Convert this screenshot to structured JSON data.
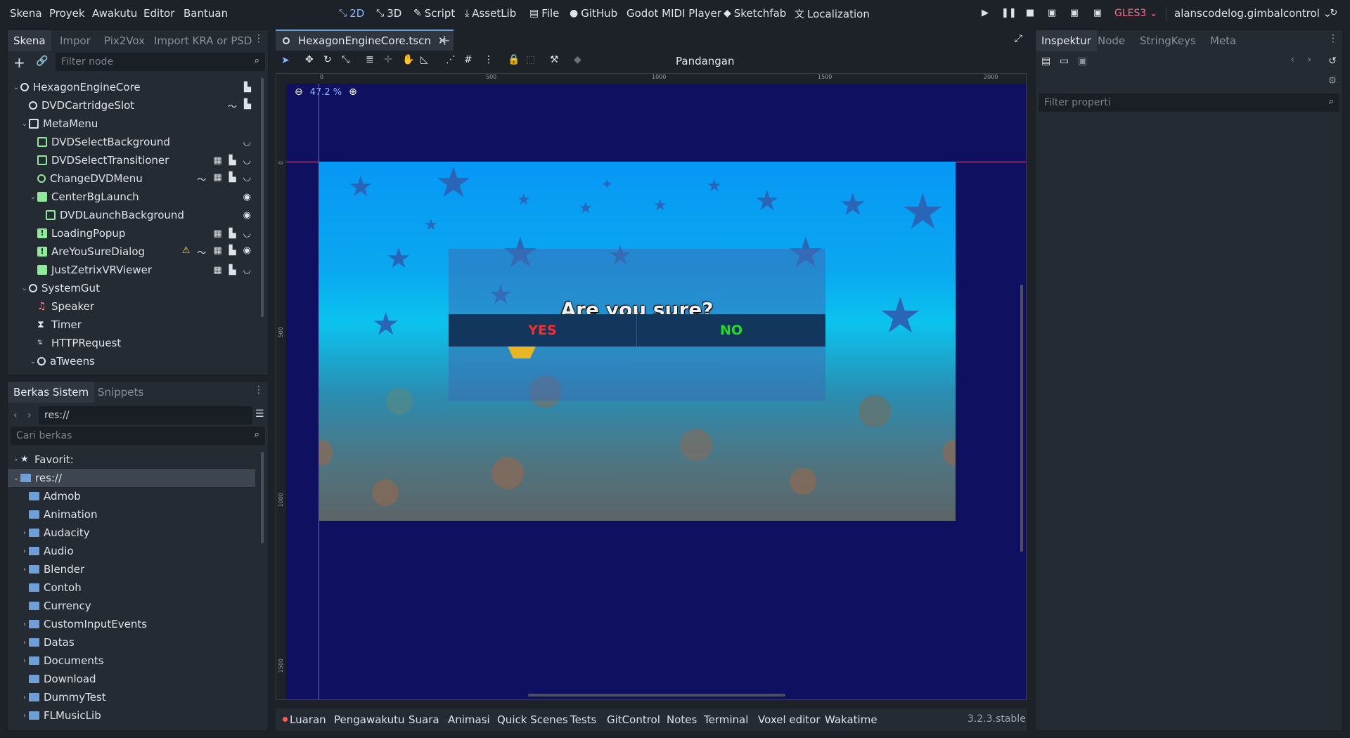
{
  "menu": [
    "Skena",
    "Proyek",
    "Awakutu",
    "Editor",
    "Bantuan"
  ],
  "workspaces": [
    {
      "label": "2D",
      "icon": "2d-icon"
    },
    {
      "label": "3D",
      "icon": "3d-icon"
    },
    {
      "label": "Script",
      "icon": "script-icon"
    },
    {
      "label": "AssetLib",
      "icon": "assetlib-icon"
    },
    {
      "label": "File",
      "icon": "file-icon"
    },
    {
      "label": "GitHub",
      "icon": "github-icon"
    },
    {
      "label": "Godot MIDI Player",
      "icon": ""
    },
    {
      "label": "Sketchfab",
      "icon": "sketchfab-icon"
    },
    {
      "label": "Localization",
      "icon": "localization-icon"
    }
  ],
  "renderer": "GLES3",
  "project_name": "alanscodelog.gimbalcontrol",
  "scene_dock": {
    "tabs": [
      "Skena",
      "Impor",
      "Pix2Vox",
      "Import KRA or PSD"
    ],
    "filter_placeholder": "Filter node",
    "nodes": [
      {
        "label": "HexagonEngineCore",
        "depth": 0,
        "expanded": true,
        "icon": "ring"
      },
      {
        "label": "DVDCartridgeSlot",
        "depth": 1,
        "icon": "ring"
      },
      {
        "label": "MetaMenu",
        "depth": 1,
        "expanded": true,
        "icon": "checkbox"
      },
      {
        "label": "DVDSelectBackground",
        "depth": 2,
        "icon": "texture"
      },
      {
        "label": "DVDSelectTransitioner",
        "depth": 2,
        "icon": "texture"
      },
      {
        "label": "ChangeDVDMenu",
        "depth": 2,
        "icon": "ring"
      },
      {
        "label": "CenterBgLaunch",
        "depth": 2,
        "expanded": true,
        "icon": "center"
      },
      {
        "label": "DVDLaunchBackground",
        "depth": 3,
        "icon": "texture"
      },
      {
        "label": "LoadingPopup",
        "depth": 2,
        "icon": "alert"
      },
      {
        "label": "AreYouSureDialog",
        "depth": 2,
        "icon": "alert"
      },
      {
        "label": "JustZetrixVRViewer",
        "depth": 2,
        "icon": "panel"
      },
      {
        "label": "SystemGut",
        "depth": 1,
        "expanded": true,
        "icon": "ring"
      },
      {
        "label": "Speaker",
        "depth": 2,
        "icon": "audio"
      },
      {
        "label": "Timer",
        "depth": 2,
        "icon": "timer"
      },
      {
        "label": "HTTPRequest",
        "depth": 2,
        "icon": "http"
      },
      {
        "label": "aTweens",
        "depth": 2,
        "expanded": true,
        "icon": "ring"
      }
    ]
  },
  "filesystem_dock": {
    "tabs": [
      "Berkas Sistem",
      "Snippets"
    ],
    "path": "res://",
    "search_placeholder": "Cari berkas",
    "items": [
      {
        "label": "Favorit:",
        "depth": 0,
        "icon": "star",
        "collapsed": true
      },
      {
        "label": "res://",
        "depth": 0,
        "icon": "folder",
        "expanded": true,
        "selected": true
      },
      {
        "label": "Admob",
        "depth": 1
      },
      {
        "label": "Animation",
        "depth": 1
      },
      {
        "label": "Audacity",
        "depth": 1,
        "collapsed": true
      },
      {
        "label": "Audio",
        "depth": 1,
        "collapsed": true
      },
      {
        "label": "Blender",
        "depth": 1,
        "collapsed": true
      },
      {
        "label": "Contoh",
        "depth": 1
      },
      {
        "label": "Currency",
        "depth": 1
      },
      {
        "label": "CustomInputEvents",
        "depth": 1,
        "collapsed": true
      },
      {
        "label": "Datas",
        "depth": 1,
        "collapsed": true
      },
      {
        "label": "Documents",
        "depth": 1,
        "collapsed": true
      },
      {
        "label": "Download",
        "depth": 1
      },
      {
        "label": "DummyTest",
        "depth": 1,
        "collapsed": true
      },
      {
        "label": "FLMusicLib",
        "depth": 1,
        "collapsed": true
      }
    ]
  },
  "editor": {
    "scene_tab": "HexagonEngineCore.tscn",
    "toolbar_view_label": "Pandangan",
    "zoom": "47.2 %",
    "ruler_h": [
      "0",
      "500",
      "1000",
      "1500",
      "2000"
    ],
    "ruler_v": [
      "0",
      "500",
      "1000",
      "1500"
    ]
  },
  "game": {
    "dialog_title": "Are you sure?sdffffffffffffffffffffffds",
    "yes_label": "YES",
    "no_label": "NO",
    "colors": {
      "yes": "#ff2a2a",
      "no": "#22dd22",
      "background_top": "#0797f5",
      "viewport": "#0f1060"
    }
  },
  "inspector": {
    "tabs": [
      "Inspektur",
      "Node",
      "StringKeys",
      "Meta"
    ],
    "filter_placeholder": "Filter properti"
  },
  "bottom_panel": {
    "tabs": [
      "Luaran",
      "Pengawakutu",
      "Suara",
      "Animasi",
      "Quick Scenes",
      "Tests",
      "GitControl",
      "Notes",
      "Terminal",
      "Voxel editor",
      "Wakatime"
    ],
    "version": "3.2.3.stable"
  }
}
